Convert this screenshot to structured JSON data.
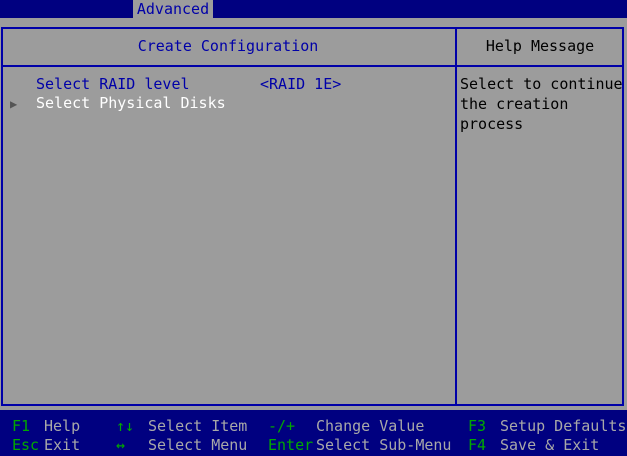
{
  "tabs": {
    "active": "Advanced"
  },
  "panel": {
    "title": "Create Configuration",
    "options": [
      {
        "label": "Select RAID level",
        "value": "<RAID 1E>"
      }
    ],
    "submenus": [
      {
        "arrow": "▶",
        "label": "Select Physical Disks"
      }
    ]
  },
  "help": {
    "title": "Help Message",
    "text_line1": "Select to continue",
    "text_line2": "the creation process"
  },
  "footer": {
    "k1": "F1",
    "d1": "Help",
    "k2": "Esc",
    "d2": "Exit",
    "k3": "↑↓",
    "d3": "Select Item",
    "k4": "↔",
    "d4": "Select Menu",
    "k5": "-/+",
    "d5": "Change Value",
    "k6": "Enter",
    "d6": "Select Sub-Menu",
    "k7": "F3",
    "d7": "Setup Defaults",
    "k8": "F4",
    "d8": "Save & Exit"
  },
  "colors": {
    "background": "#000080",
    "panel": "#9c9c9c",
    "accent_text": "#0000a8",
    "highlight_text": "#ffffff",
    "footer_key": "#00a800"
  }
}
